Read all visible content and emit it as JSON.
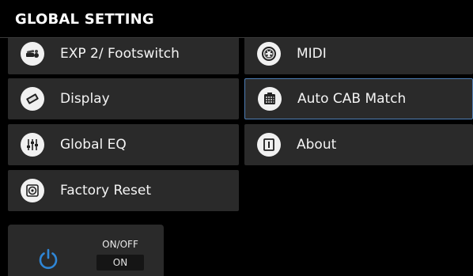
{
  "header": {
    "title": "GLOBAL SETTING"
  },
  "menu": {
    "items": [
      {
        "label": "EXP 2/ Footswitch",
        "icon": "footswitch-icon"
      },
      {
        "label": "MIDI",
        "icon": "midi-icon"
      },
      {
        "label": "Display",
        "icon": "display-icon"
      },
      {
        "label": "Auto CAB Match",
        "icon": "cab-icon",
        "selected": true
      },
      {
        "label": "Global EQ",
        "icon": "eq-sliders-icon"
      },
      {
        "label": "About",
        "icon": "info-icon"
      },
      {
        "label": "Factory Reset",
        "icon": "factory-reset-icon"
      }
    ]
  },
  "power": {
    "caption": "ON/OFF",
    "status": "ON",
    "icon": "power-icon",
    "accent": "#2f86d6"
  },
  "colors": {
    "background": "#000000",
    "panel": "#2a2a2a",
    "selected_border": "#4f7fb6"
  }
}
